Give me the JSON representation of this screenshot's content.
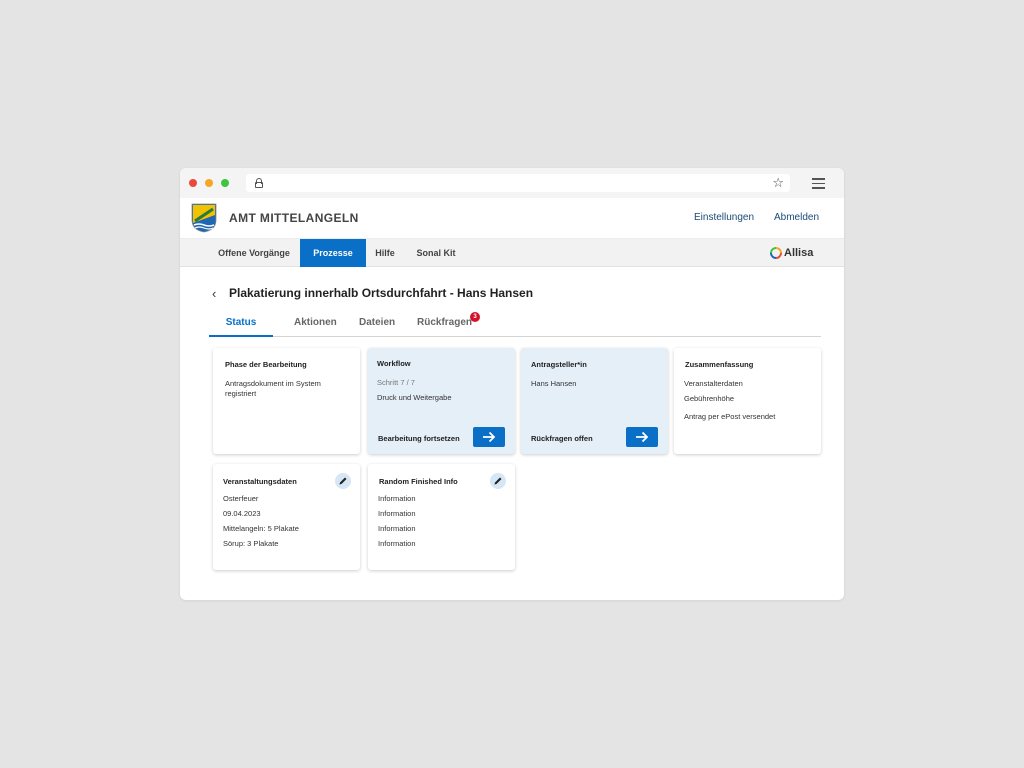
{
  "header": {
    "brand": "AMT MITTELANGELN",
    "settings_label": "Einstellungen",
    "logout_label": "Abmelden"
  },
  "nav": {
    "items": [
      {
        "label": "Offene Vorgänge"
      },
      {
        "label": "Prozesse",
        "active": true
      },
      {
        "label": "Hilfe"
      },
      {
        "label": "Sonal Kit"
      }
    ],
    "logo_text": "Allisa"
  },
  "page": {
    "title": "Plakatierung innerhalb Ortsdurchfahrt - Hans Hansen"
  },
  "tabs": {
    "items": [
      {
        "label": "Status",
        "active": true
      },
      {
        "label": "Aktionen"
      },
      {
        "label": "Dateien"
      },
      {
        "label": "Rückfragen"
      }
    ],
    "rueckfragen_badge": "3"
  },
  "cards": {
    "phase": {
      "title": "Phase der Bearbeitung",
      "text": "Antragsdokument im System registriert"
    },
    "workflow": {
      "title": "Workflow",
      "step": "Schritt 7 / 7",
      "step_name": "Druck und Weitergabe",
      "action": "Bearbeitung fortsetzen"
    },
    "antragsteller": {
      "title": "Antragsteller*in",
      "name": "Hans Hansen",
      "action": "Rückfragen offen"
    },
    "zusammenfassung": {
      "title": "Zusammenfassung",
      "lines": [
        "Veranstalterdaten",
        "Gebührenhöhe",
        "Antrag per ePost versendet"
      ]
    },
    "veranstaltung": {
      "title": "Veranstaltungsdaten",
      "lines": [
        "Osterfeuer",
        "09.04.2023",
        "Mittelangeln: 5 Plakate",
        "Sörup: 3 Plakate"
      ]
    },
    "random": {
      "title": "Random Finished Info",
      "lines": [
        "Information",
        "Information",
        "Information",
        "Information"
      ]
    }
  },
  "colors": {
    "accent": "#0a6fc7",
    "card_highlight": "#e5eff8",
    "badge": "#d6122a"
  }
}
